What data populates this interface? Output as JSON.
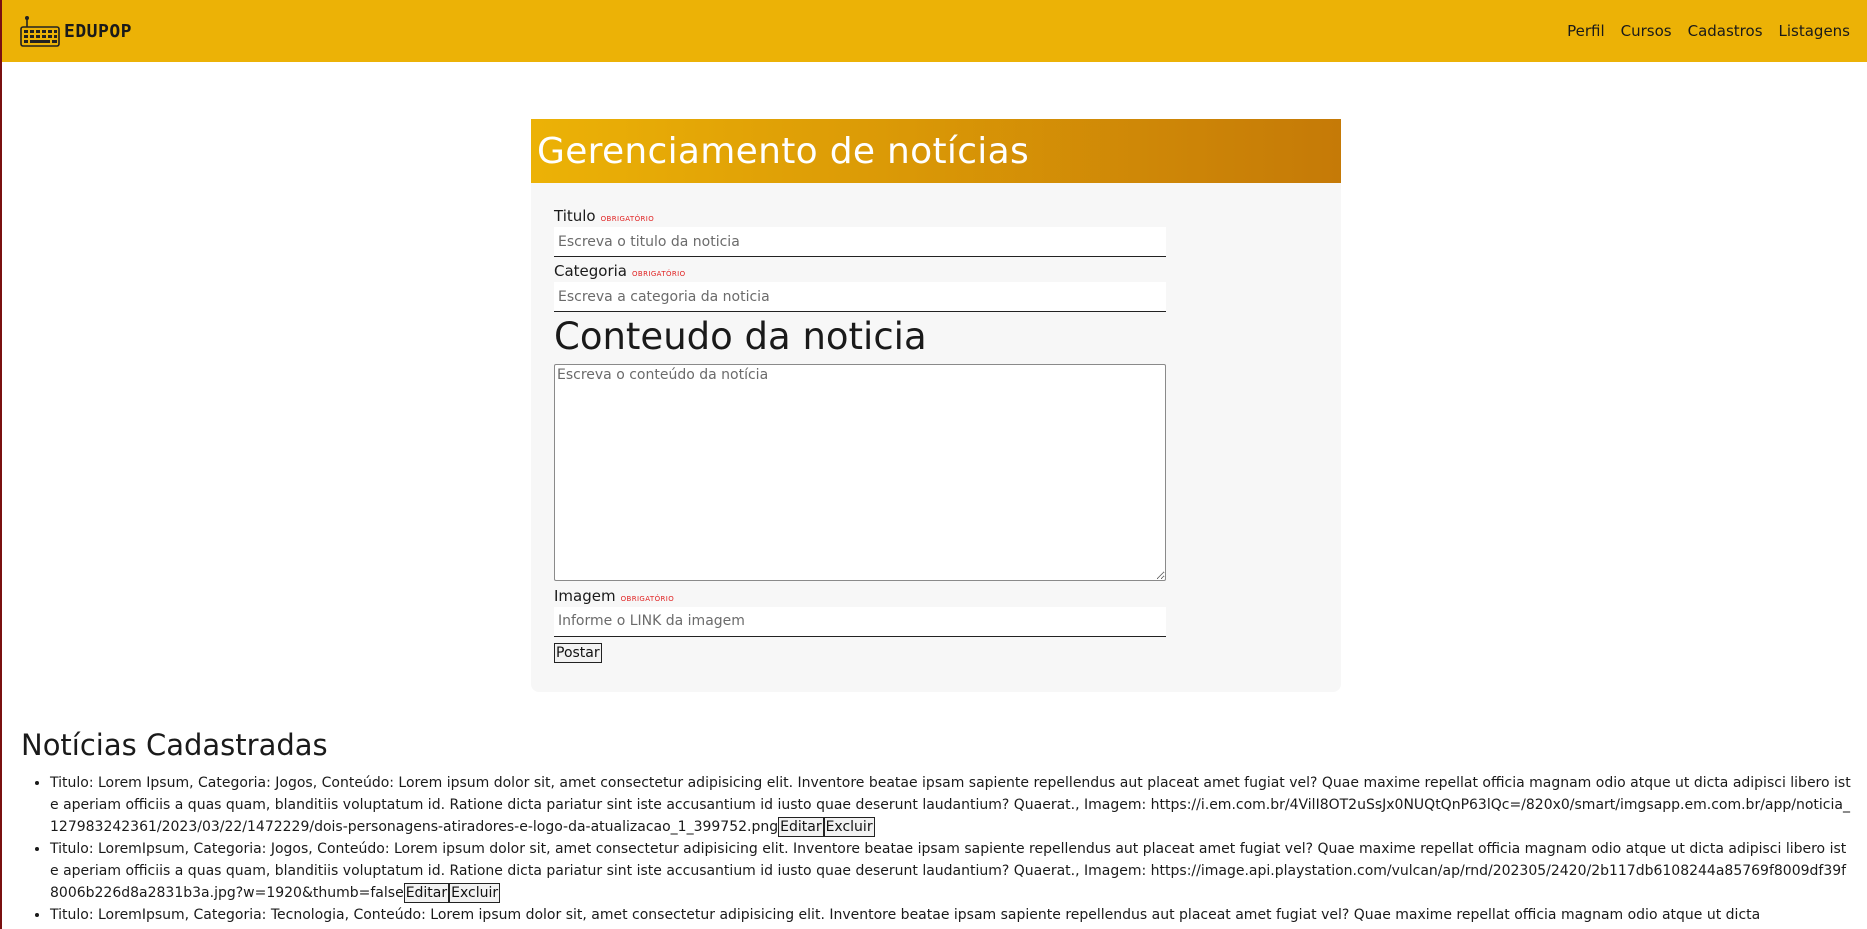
{
  "navbar": {
    "brand": "EDUPOP",
    "links": [
      "Perfil",
      "Cursos",
      "Cadastros",
      "Listagens"
    ]
  },
  "form": {
    "header_title": "Gerenciamento de notícias",
    "required_label": "OBRIGATÓRIO",
    "titulo_label": "Titulo",
    "titulo_placeholder": "Escreva o titulo da noticia",
    "categoria_label": "Categoria",
    "categoria_placeholder": "Escreva a categoria da noticia",
    "conteudo_heading": "Conteudo da noticia",
    "conteudo_placeholder": "Escreva o conteúdo da notícia",
    "imagem_label": "Imagem",
    "imagem_placeholder": "Informe o LINK da imagem",
    "post_button": "Postar"
  },
  "list": {
    "title": "Notícias Cadastradas",
    "edit_label": "Editar",
    "delete_label": "Excluir",
    "items": [
      {
        "text": "Titulo: Lorem Ipsum, Categoria: Jogos, Conteúdo: Lorem ipsum dolor sit, amet consectetur adipisicing elit. Inventore beatae ipsam sapiente repellendus aut placeat amet fugiat vel? Quae maxime repellat officia magnam odio atque ut dicta adipisci libero iste aperiam officiis a quas quam, blanditiis voluptatum id. Ratione dicta pariatur sint iste accusantium id iusto quae deserunt laudantium? Quaerat., Imagem: https://i.em.com.br/4VilI8OT2uSsJx0NUQtQnP63lQc=/820x0/smart/imgsapp.em.com.br/app/noticia_127983242361/2023/03/22/1472229/dois-personagens-atiradores-e-logo-da-atualizacao_1_399752.png"
      },
      {
        "text": "Titulo: LoremIpsum, Categoria: Jogos, Conteúdo: Lorem ipsum dolor sit, amet consectetur adipisicing elit. Inventore beatae ipsam sapiente repellendus aut placeat amet fugiat vel? Quae maxime repellat officia magnam odio atque ut dicta adipisci libero iste aperiam officiis a quas quam, blanditiis voluptatum id. Ratione dicta pariatur sint iste accusantium id iusto quae deserunt laudantium? Quaerat., Imagem: https://image.api.playstation.com/vulcan/ap/rnd/202305/2420/2b117db6108244a85769f8009df39f8006b226d8a2831b3a.jpg?w=1920&thumb=false"
      },
      {
        "text": "Titulo: LoremIpsum, Categoria: Tecnologia, Conteúdo: Lorem ipsum dolor sit, amet consectetur adipisicing elit. Inventore beatae ipsam sapiente repellendus aut placeat amet fugiat vel? Quae maxime repellat officia magnam odio atque ut dicta"
      }
    ]
  },
  "colors": {
    "navbar": "#ecb206",
    "header_gradient_start": "#ecb206",
    "header_gradient_end": "#c57a07",
    "required": "#e02020"
  }
}
